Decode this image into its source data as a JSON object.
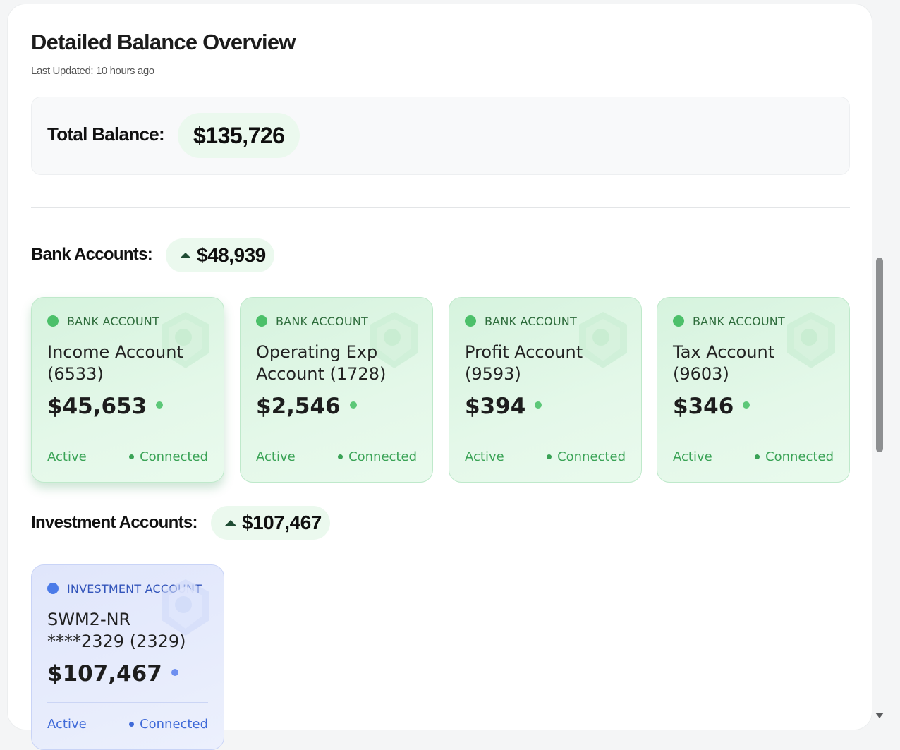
{
  "header": {
    "title": "Detailed Balance Overview",
    "last_updated": "Last Updated: 10 hours ago"
  },
  "total": {
    "label": "Total Balance:",
    "value": "$135,726"
  },
  "bank_section": {
    "label": "Bank Accounts:",
    "total": "$48,939",
    "trend": "up"
  },
  "investment_section": {
    "label": "Investment Accounts:",
    "total": "$107,467",
    "trend": "up"
  },
  "bank_accounts": [
    {
      "type": "BANK ACCOUNT",
      "name": "Income Account (6533)",
      "amount": "$45,653",
      "status": "Active",
      "connection": "Connected"
    },
    {
      "type": "BANK ACCOUNT",
      "name": "Operating Exp Account (1728)",
      "amount": "$2,546",
      "status": "Active",
      "connection": "Connected"
    },
    {
      "type": "BANK ACCOUNT",
      "name": "Profit Account (9593)",
      "amount": "$394",
      "status": "Active",
      "connection": "Connected"
    },
    {
      "type": "BANK ACCOUNT",
      "name": "Tax Account (9603)",
      "amount": "$346",
      "status": "Active",
      "connection": "Connected"
    }
  ],
  "investment_accounts": [
    {
      "type": "INVESTMENT ACCOUNT",
      "name": "SWM2-NR ****2329 (2329)",
      "amount": "$107,467",
      "status": "Active",
      "connection": "Connected"
    }
  ],
  "colors": {
    "bank_accent": "#4cc06a",
    "investment_accent": "#4b7be8",
    "pill_bg": "#ebf9ee",
    "trend_up": "#1f4c33"
  },
  "icons": {
    "card_watermark": "shield-icon",
    "trend": "caret-up-icon"
  }
}
